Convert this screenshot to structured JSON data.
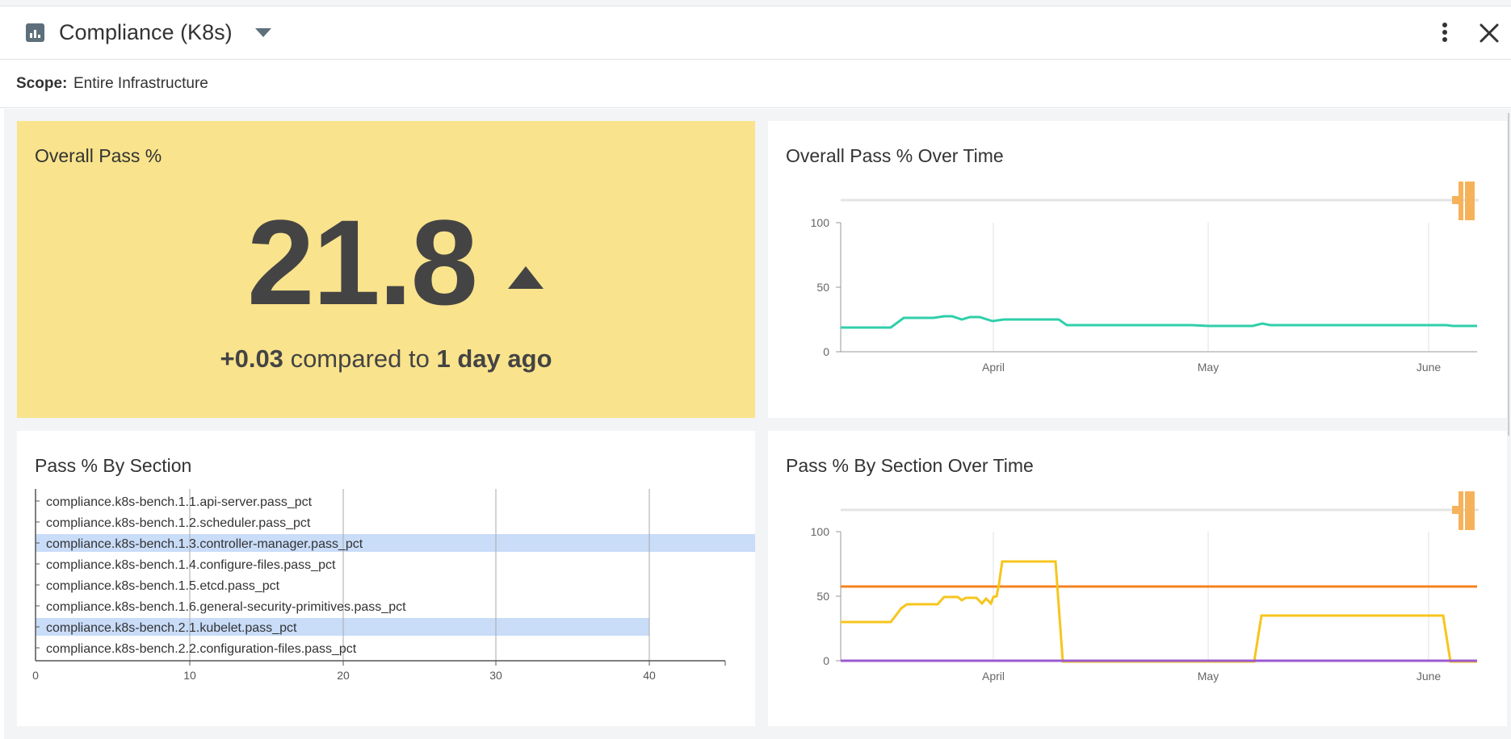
{
  "header": {
    "title": "Compliance (K8s)"
  },
  "scope": {
    "label": "Scope:",
    "value": "Entire Infrastructure"
  },
  "overall_pass": {
    "title": "Overall Pass %",
    "value": "21.8",
    "delta": "+0.03",
    "compare_text": "compared to",
    "period": "1 day ago"
  },
  "over_time": {
    "title": "Overall Pass % Over Time"
  },
  "by_section": {
    "title": "Pass % By Section"
  },
  "by_section_over_time": {
    "title": "Pass % By Section Over Time"
  },
  "colors": {
    "accent_yellow": "#f9e38c",
    "teal": "#2fcfaa",
    "orange": "#f5821f",
    "gold": "#f7c51c",
    "purple": "#9b59d0",
    "highlight": "#c9dcf8"
  },
  "chart_data": [
    {
      "type": "line",
      "x": [
        "Mar 10",
        "Mar 20",
        "Mar 25",
        "Apr 1",
        "Apr 10",
        "Apr 15",
        "May 1",
        "May 10",
        "May 20",
        "Jun 1",
        "Jun 5"
      ],
      "series": [
        {
          "values": [
            19,
            19,
            25,
            25,
            25,
            21,
            21,
            21,
            21,
            21,
            21
          ]
        }
      ],
      "ylim": [
        0,
        100
      ],
      "yticks": [
        "0",
        "50",
        "100"
      ],
      "xticks": [
        "April",
        "May",
        "June"
      ]
    },
    {
      "type": "bar",
      "categories": [
        "compliance.k8s-bench.1.1.api-server.pass_pct",
        "compliance.k8s-bench.1.2.scheduler.pass_pct",
        "compliance.k8s-bench.1.3.controller-manager.pass_pct",
        "compliance.k8s-bench.1.4.configure-files.pass_pct",
        "compliance.k8s-bench.1.5.etcd.pass_pct",
        "compliance.k8s-bench.1.6.general-security-primitives.pass_pct",
        "compliance.k8s-bench.2.1.kubelet.pass_pct",
        "compliance.k8s-bench.2.2.configuration-files.pass_pct"
      ],
      "values": [
        0,
        0,
        57,
        0,
        0,
        0,
        40,
        0
      ],
      "xlim": [
        0,
        45
      ],
      "xticks": [
        "0",
        "10",
        "20",
        "30",
        "40"
      ]
    },
    {
      "type": "line",
      "series": [
        {
          "values": [
            57,
            57,
            57,
            57,
            57,
            57,
            57
          ]
        },
        {
          "values": [
            30,
            30,
            42,
            48,
            80,
            0,
            36
          ]
        },
        {
          "values": [
            0,
            0,
            0,
            0,
            0,
            0,
            0
          ]
        }
      ],
      "ylim": [
        0,
        100
      ],
      "yticks": [
        "0",
        "50",
        "100"
      ],
      "xticks": [
        "April",
        "May",
        "June"
      ]
    }
  ]
}
